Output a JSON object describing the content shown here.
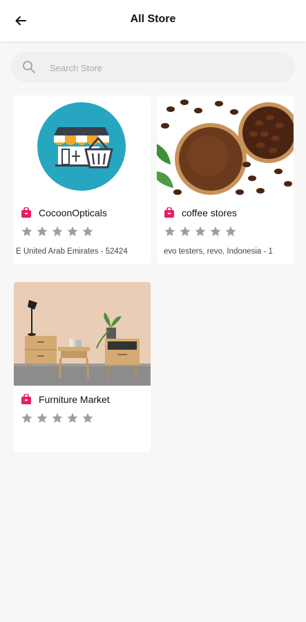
{
  "header": {
    "title": "All Store",
    "back_icon": "arrow-left-icon"
  },
  "search": {
    "placeholder": "Search Store",
    "value": "",
    "icon": "search-icon"
  },
  "colors": {
    "accent": "#e91e63",
    "star": "#9e9e9e",
    "background": "#f7f7f7"
  },
  "stores": [
    {
      "name": "CocoonOpticals",
      "rating": 0,
      "address": "E United Arab Emirates - 52424",
      "icon": "shopping-bag-icon",
      "image": "store-basket-logo"
    },
    {
      "name": "coffee stores",
      "rating": 0,
      "address": "evo testers, revo,  Indonesia - 1",
      "icon": "shopping-bag-icon",
      "image": "coffee-beans-photo"
    },
    {
      "name": "Furniture Market",
      "rating": 0,
      "address": "",
      "icon": "shopping-bag-icon",
      "image": "furniture-room-photo"
    }
  ]
}
